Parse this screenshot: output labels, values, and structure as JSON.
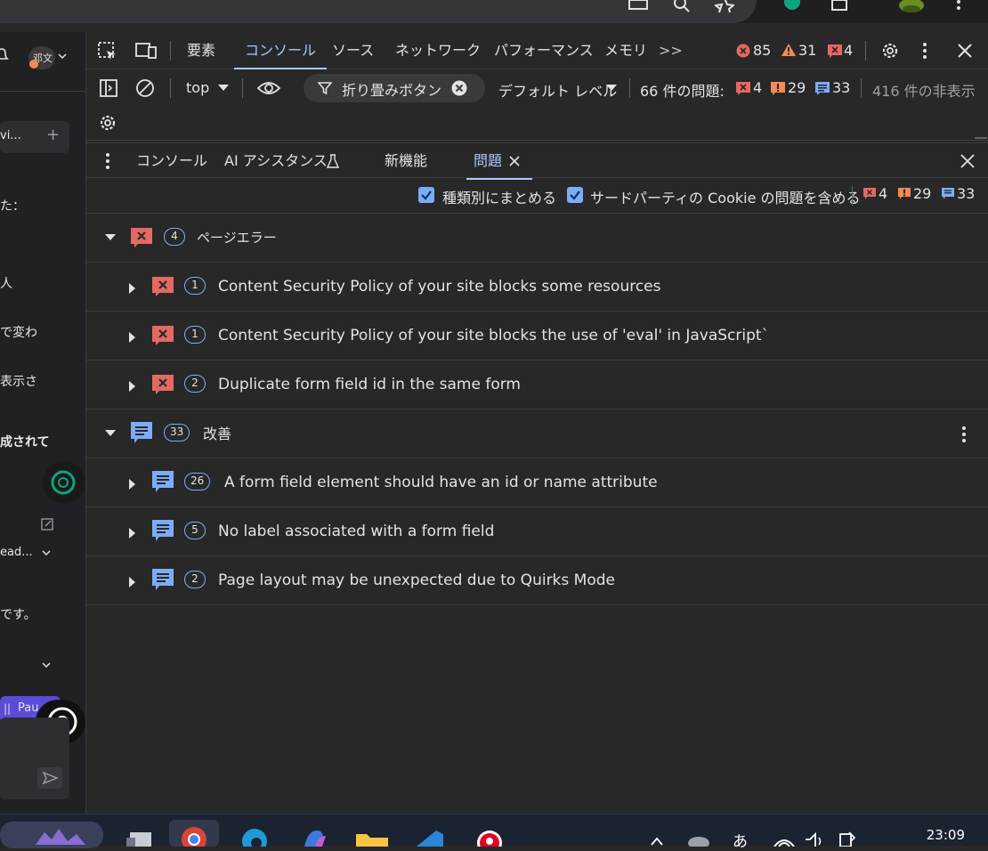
{
  "browser": {
    "profile_label": "邓文"
  },
  "page_left": {
    "texts": [
      "vi...",
      "た：",
      "人",
      "で変わ",
      "表示さ",
      "成されて",
      "ead...",
      "です。",
      "Pau"
    ]
  },
  "devtools": {
    "main_tabs": [
      {
        "label": "要素"
      },
      {
        "label": "コンソール",
        "active": true
      },
      {
        "label": "ソース"
      },
      {
        "label": "ネットワーク"
      },
      {
        "label": "パフォーマンス"
      },
      {
        "label": "メモリ"
      }
    ],
    "more_tabs": ">>",
    "counts": {
      "errors": "85",
      "warnings": "31",
      "issues": "4"
    },
    "console_toolbar": {
      "context": "top",
      "filter_text": "折り畳みボタン",
      "level": "デフォルト レベル",
      "issues_label": "66 件の問題:",
      "issue_errors": "4",
      "issue_warnings": "29",
      "issue_info": "33",
      "hidden": "416 件の非表示"
    },
    "drawer_tabs": [
      {
        "label": "コンソール"
      },
      {
        "label": "AI アシスタンス"
      },
      {
        "label": "新機能"
      },
      {
        "label": "問題",
        "active": true
      }
    ],
    "issues_toolbar": {
      "group_by_kind": "種類別にまとめる",
      "include_third_party": "サードパーティの Cookie の問題を含める",
      "errors": "4",
      "warnings": "29",
      "info": "33"
    },
    "groups": [
      {
        "kind": "error",
        "count": "4",
        "title": "ページエラー",
        "items": [
          {
            "count": "1",
            "text": "Content Security Policy of your site blocks some resources"
          },
          {
            "count": "1",
            "text": "Content Security Policy of your site blocks the use of 'eval' in JavaScript`"
          },
          {
            "count": "2",
            "text": "Duplicate form field id in the same form"
          }
        ]
      },
      {
        "kind": "info",
        "count": "33",
        "title": "改善",
        "items": [
          {
            "count": "26",
            "text": "A form field element should have an id or name attribute"
          },
          {
            "count": "5",
            "text": "No label associated with a form field"
          },
          {
            "count": "2",
            "text": "Page layout may be unexpected due to Quirks Mode"
          }
        ]
      }
    ]
  },
  "taskbar": {
    "clock": "23:09",
    "ime": "あ"
  },
  "colors": {
    "error": "#e46962",
    "warning": "#f28b54",
    "info": "#7cacf8",
    "accent": "#a8c7fa"
  }
}
